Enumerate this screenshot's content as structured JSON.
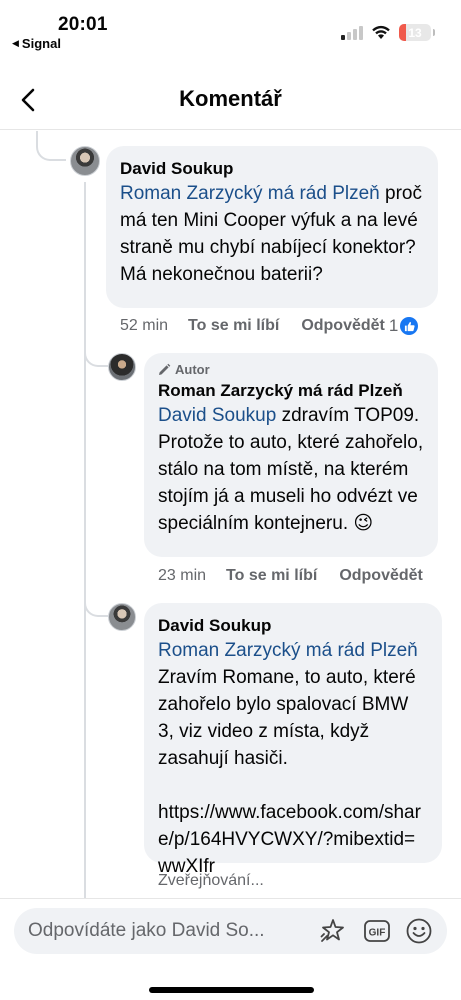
{
  "status_bar": {
    "time": "20:01",
    "back_app": "Signal",
    "battery": "13",
    "battery_fraction": 0.13
  },
  "header": {
    "title": "Komentář",
    "back_icon": "chevron-left-icon"
  },
  "comments": [
    {
      "author": "David Soukup",
      "mention": "Roman Zarzycký má rád Plzeň",
      "text": "proč má ten Mini Cooper výfuk a na levé straně mu chybí nabíjecí konektor? Má nekonečnou baterii?",
      "time_ago": "52 min",
      "like_label": "To se mi líbí",
      "reply_label": "Odpovědět",
      "like_count": "1"
    },
    {
      "badge": "Autor",
      "author": "Roman Zarzycký má rád Plzeň",
      "mention": "David Soukup",
      "text": "zdravím TOP09. Protože to auto, které zahořelo, stálo na tom místě, na kterém stojím já a museli ho odvézt ve speciálním kontejneru. 😉",
      "time_ago": "23 min",
      "like_label": "To se mi líbí",
      "reply_label": "Odpovědět"
    },
    {
      "author": "David Soukup",
      "mention": "Roman Zarzycký má rád Plzeň",
      "text": "Zravím Romane, to auto, které zahořelo bylo spalovací BMW 3, viz video z místa, když zasahují hasiči.",
      "link": "https://www.facebook.com/share/p/164HVYCWXY/?mibextid=wwXIfr",
      "status": "Zveřejňování..."
    }
  ],
  "composer": {
    "placeholder": "Odpovídáte jako David So...",
    "icons": [
      "avatar-sticker-icon",
      "gif-icon",
      "emoji-icon"
    ]
  },
  "colors": {
    "accent": "#1877f2",
    "mention": "#1b4f8a",
    "bubble": "#f0f2f5",
    "secondary_text": "#65676b"
  }
}
